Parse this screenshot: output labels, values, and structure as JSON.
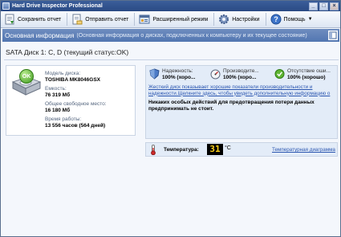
{
  "window": {
    "title": "Hard Drive Inspector Professional"
  },
  "toolbar": {
    "save_report": "Сохранить отчет",
    "send_report": "Отправить отчет",
    "advanced_mode": "Расширенный режим",
    "settings": "Настройки",
    "help": "Помощь"
  },
  "section": {
    "title": "Основная информация",
    "subtitle": "(Основная информация о дисках, подключенных к компьютеру и  их текущее состояние)"
  },
  "disk": {
    "title": "SATA Диск 1: C, D (текущий статус:OK)",
    "status_badge": "OK",
    "model_label": "Модель диска:",
    "model_value": "TOSHIBA MK8046GSX",
    "capacity_label": "Емкость:",
    "capacity_value": "76 319 Мб",
    "free_label": "Общее свободное место:",
    "free_value": "16 180 Мб",
    "uptime_label": "Время работы:",
    "uptime_value": "13 556 часов (564 дней)"
  },
  "metrics": {
    "reliability_label": "Надежность:",
    "reliability_value": "100% (хоро...",
    "performance_label": "Производите...",
    "performance_value": "100% (хоро...",
    "errors_label": "Отсутствие оши...",
    "errors_value": "100% (хорошо)"
  },
  "info": {
    "link_line1": "Жесткий диск показывает хорошие показатели производительности и",
    "link_line2": "надежности.Щелкните здесь, чтобы увидеть дополнительную информацию о",
    "advice_line1": "Никаких особых действий для предотвращения потери данных",
    "advice_line2": "предпринимать не стоит."
  },
  "temperature": {
    "label": "Температура:",
    "value": "31",
    "unit": "°C",
    "chart_link": "Температурная диаграмма"
  },
  "colors": {
    "accent": "#5276b1",
    "link": "#2b56b0",
    "ok_green": "#3e9a1d",
    "temp_digits": "#ffd21a"
  }
}
